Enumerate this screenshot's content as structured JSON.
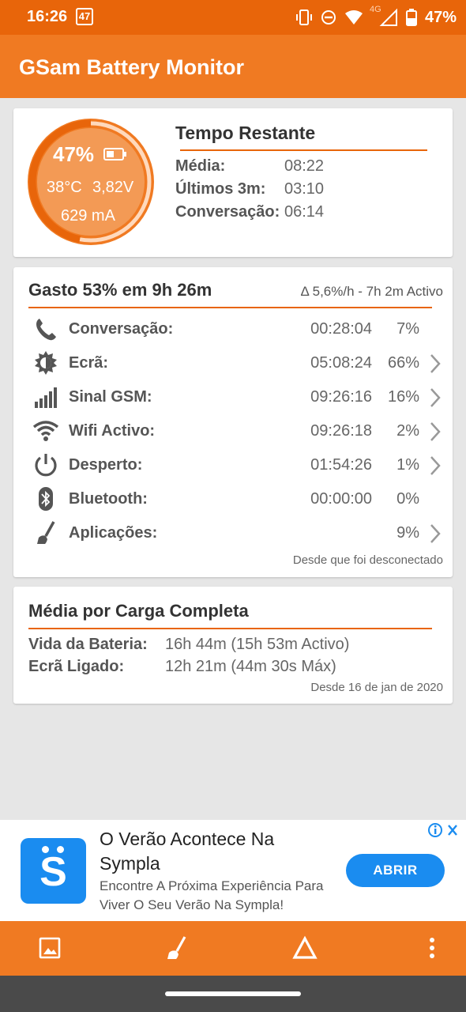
{
  "status_bar": {
    "time": "16:26",
    "notification_badge": "47",
    "battery_percent": "47%",
    "network_type": "4G",
    "icons": [
      "vibrate-icon",
      "do-not-disturb-icon",
      "wifi-icon",
      "cellular-signal-icon",
      "battery-icon"
    ]
  },
  "app_bar": {
    "title": "GSam Battery Monitor"
  },
  "gauge": {
    "percent": "47%",
    "level": 0.47,
    "temperature": "38°C",
    "voltage": "3,82V",
    "current": "629 mA"
  },
  "remaining": {
    "title": "Tempo Restante",
    "rows": [
      {
        "label": "Média:",
        "value": "08:22"
      },
      {
        "label": "Últimos 3m:",
        "value": "03:10"
      },
      {
        "label": "Conversação:",
        "value": "06:14"
      }
    ]
  },
  "usage": {
    "title": "Gasto 53% em 9h 26m",
    "rate": "Δ 5,6%/h - 7h 2m Activo",
    "rows": [
      {
        "icon": "phone-icon",
        "label": "Conversação:",
        "time": "00:28:04",
        "percent": "7%",
        "chevron": false
      },
      {
        "icon": "brightness-icon",
        "label": "Ecrã:",
        "time": "05:08:24",
        "percent": "66%",
        "chevron": true
      },
      {
        "icon": "signal-bars-icon",
        "label": "Sinal GSM:",
        "time": "09:26:16",
        "percent": "16%",
        "chevron": true
      },
      {
        "icon": "wifi-icon",
        "label": "Wifi Activo:",
        "time": "09:26:18",
        "percent": "2%",
        "chevron": true
      },
      {
        "icon": "power-icon",
        "label": "Desperto:",
        "time": "01:54:26",
        "percent": "1%",
        "chevron": true
      },
      {
        "icon": "bluetooth-icon",
        "label": "Bluetooth:",
        "time": "00:00:00",
        "percent": "0%",
        "chevron": false
      },
      {
        "icon": "broom-icon",
        "label": "Aplicações:",
        "time": "",
        "percent": "9%",
        "chevron": true
      }
    ],
    "footer": "Desde que foi desconectado"
  },
  "average": {
    "title": "Média por Carga Completa",
    "rows": [
      {
        "label": "Vida da Bateria:",
        "value": "16h 44m (15h 53m Activo)"
      },
      {
        "label": "Ecrã Ligado:",
        "value": "12h 21m (44m 30s Máx)"
      }
    ],
    "footer": "Desde 16 de jan de 2020"
  },
  "ad": {
    "title": "O Verão Acontece Na Sympla",
    "description": "Encontre A Próxima Experiência Para Viver O Seu Verão Na Sympla!",
    "button": "ABRIR",
    "logo_letter": "S"
  },
  "bottom_bar": {
    "buttons": [
      "image-icon",
      "broom-icon",
      "delta-icon",
      "more-vert-icon"
    ]
  },
  "colors": {
    "primary": "#f07a22",
    "primary_dark": "#e8650a",
    "ad_blue": "#1a8cf0",
    "background": "#e6e6e6"
  }
}
